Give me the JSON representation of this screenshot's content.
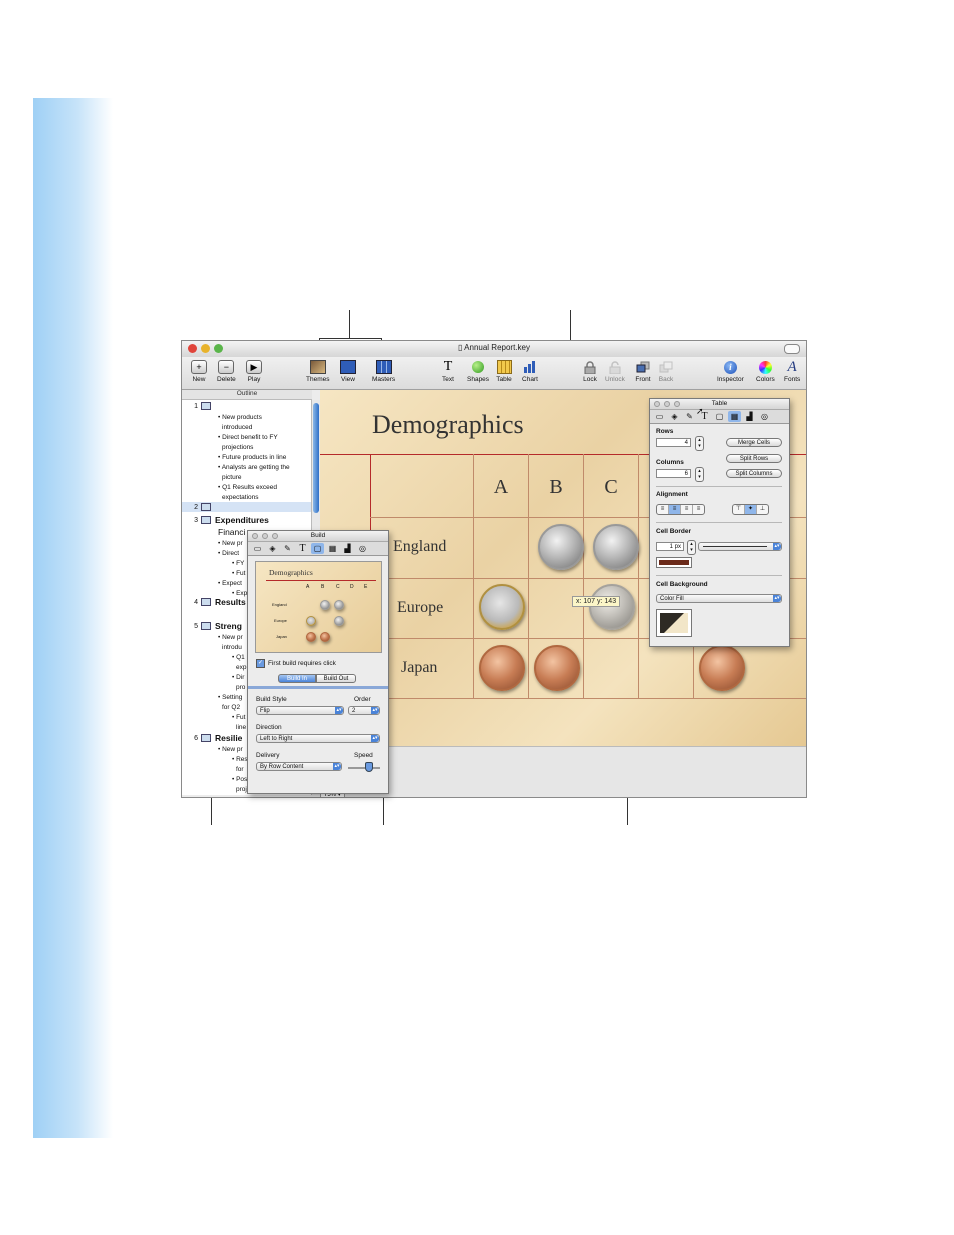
{
  "window": {
    "title": "Annual Report.key"
  },
  "toolbar": {
    "new": "New",
    "delete": "Delete",
    "play": "Play",
    "themes": "Themes",
    "view": "View",
    "masters": "Masters",
    "text": "Text",
    "shapes": "Shapes",
    "table": "Table",
    "chart": "Chart",
    "lock": "Lock",
    "unlock": "Unlock",
    "front": "Front",
    "back": "Back",
    "inspector": "Inspector",
    "colors": "Colors",
    "fonts": "Fonts"
  },
  "outline": {
    "header": "Outline",
    "slides": [
      {
        "num": "1",
        "title": "",
        "bullets": [
          "• New products",
          "introduced",
          "• Direct benefit to FY",
          "projections",
          "• Future products in line",
          "• Analysts are getting the",
          "picture",
          "• Q1 Results exceed",
          "expectations"
        ]
      },
      {
        "num": "2",
        "title": ""
      },
      {
        "num": "3",
        "title": "Expenditures",
        "sub": "Financi",
        "bullets": [
          "• New pr",
          "• Direct",
          "• FY",
          "• Fut",
          "• Expect",
          "• Exp"
        ]
      },
      {
        "num": "4",
        "title": "Results"
      },
      {
        "num": "5",
        "title": "Streng",
        "bullets": [
          "• New pr",
          "introdu",
          "• Q1",
          "exp",
          "• Dir",
          "pro",
          "• Setting",
          "for Q2",
          "• Fut",
          "line"
        ]
      },
      {
        "num": "6",
        "title": "Resilie",
        "bullets": [
          "• New pr",
          "• Res",
          "for",
          "• Positive FY",
          "projections"
        ]
      }
    ]
  },
  "slide": {
    "title": "Demographics",
    "columns": [
      "A",
      "B",
      "C"
    ],
    "rows": [
      "England",
      "Europe",
      "Japan"
    ],
    "tooltip": "x: 107  y: 143"
  },
  "zoom": "75%",
  "build_palette": {
    "title": "Build",
    "preview_title": "Demographics",
    "preview_cols": [
      "A",
      "B",
      "C",
      "D",
      "E"
    ],
    "preview_rows": [
      "England",
      "Europe",
      "Japan"
    ],
    "first_build_label": "First build requires click",
    "tab_in": "Build In",
    "tab_out": "Build Out",
    "build_style_label": "Build Style",
    "build_style_value": "Flip",
    "order_label": "Order",
    "order_value": "2",
    "direction_label": "Direction",
    "direction_value": "Left to Right",
    "delivery_label": "Delivery",
    "delivery_value": "By Row Content",
    "speed_label": "Speed"
  },
  "table_palette": {
    "title": "Table",
    "rows_label": "Rows",
    "rows_value": "4",
    "columns_label": "Columns",
    "columns_value": "6",
    "merge_cells": "Merge Cells",
    "split_rows": "Split Rows",
    "split_columns": "Split Columns",
    "alignment_label": "Alignment",
    "cell_border_label": "Cell Border",
    "border_width": "1 px",
    "cell_background_label": "Cell Background",
    "cell_background_value": "Color Fill",
    "border_color": "#6b2a1a"
  }
}
